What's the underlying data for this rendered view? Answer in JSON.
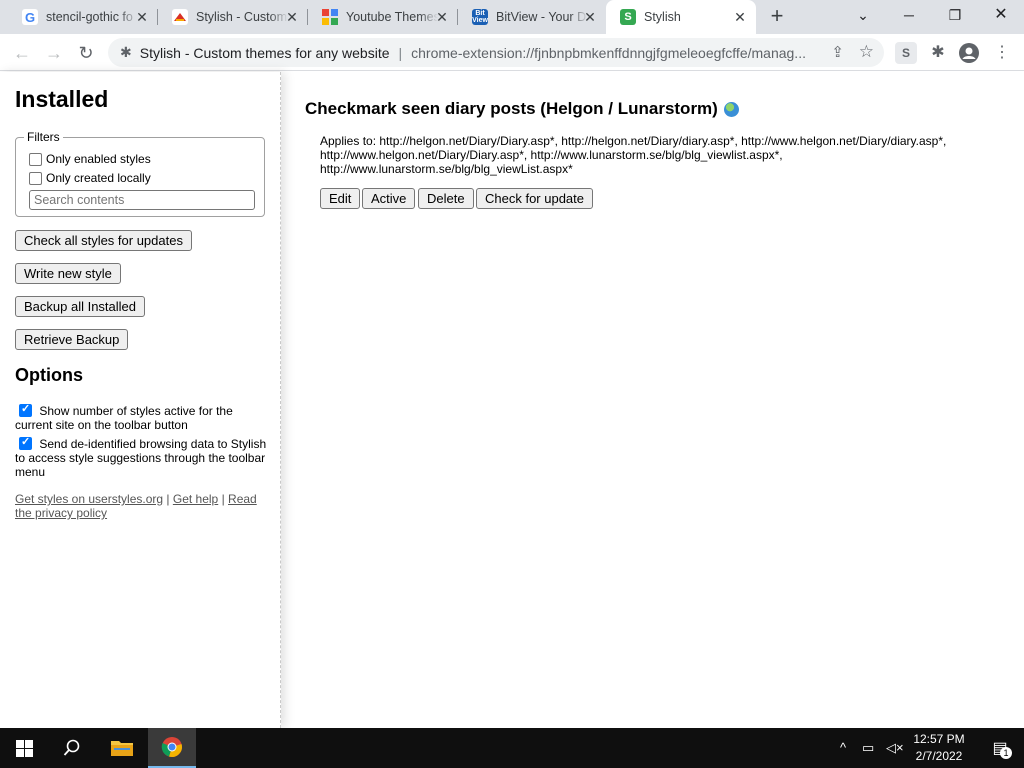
{
  "browser": {
    "tabs": [
      {
        "title": "stencil-gothic fo",
        "icon": "google-icon"
      },
      {
        "title": "Stylish - Custom",
        "icon": "stylish-hat-icon"
      },
      {
        "title": "Youtube Themes",
        "icon": "themes-icon"
      },
      {
        "title": "BitView - Your D",
        "icon": "bitview-icon"
      },
      {
        "title": "Stylish",
        "icon": "stylish-s-icon",
        "active": true
      }
    ],
    "new_tab": "+",
    "window_controls": {
      "list": "⌄",
      "minimize": "─",
      "maximize": "❐",
      "close": "✕"
    },
    "nav": {
      "back": "←",
      "forward": "→",
      "reload": "↻"
    },
    "omnibox": {
      "site_name": "Stylish - Custom themes for any website",
      "separator": "|",
      "url": "chrome-extension://fjnbnpbmkenffdnngjfgmeleoegfcffe/manag..."
    },
    "toolbar_icons": {
      "extension_s": "S",
      "puzzle": "✱",
      "profile": "●",
      "menu": "⋮",
      "share": "⇪",
      "star": "☆"
    }
  },
  "sidebar": {
    "title": "Installed",
    "filters": {
      "legend": "Filters",
      "only_enabled": {
        "label": "Only enabled styles",
        "checked": false
      },
      "only_local": {
        "label": "Only created locally",
        "checked": false
      },
      "search_placeholder": "Search contents"
    },
    "buttons": {
      "check_updates": "Check all styles for updates",
      "write_new": "Write new style",
      "backup_all": "Backup all Installed",
      "retrieve_backup": "Retrieve Backup"
    },
    "options_title": "Options",
    "options": {
      "show_count": {
        "label": "Show number of styles active for the current site on the toolbar button",
        "checked": true
      },
      "send_data": {
        "label": "Send de-identified browsing data to Stylish to access style suggestions through the toolbar menu",
        "checked": true
      }
    },
    "links": {
      "get_styles": "Get styles on userstyles.org",
      "sep1": " | ",
      "get_help": "Get help",
      "sep2": " | ",
      "privacy": "Read the privacy policy"
    }
  },
  "main": {
    "style_title": "Checkmark seen diary posts (Helgon / Lunarstorm)",
    "applies_to": "Applies to: http://helgon.net/Diary/Diary.asp*, http://helgon.net/Diary/diary.asp*, http://www.helgon.net/Diary/diary.asp*, http://www.helgon.net/Diary/Diary.asp*, http://www.lunarstorm.se/blg/blg_viewlist.aspx*, http://www.lunarstorm.se/blg/blg_viewList.aspx*",
    "buttons": {
      "edit": "Edit",
      "active": "Active",
      "delete": "Delete",
      "check_update": "Check for update"
    }
  },
  "taskbar": {
    "time": "12:57 PM",
    "date": "2/7/2022",
    "tray": {
      "chevron": "^",
      "network": "▭",
      "volume": "◁×",
      "notifications": "▤"
    },
    "notification_count": "1"
  }
}
